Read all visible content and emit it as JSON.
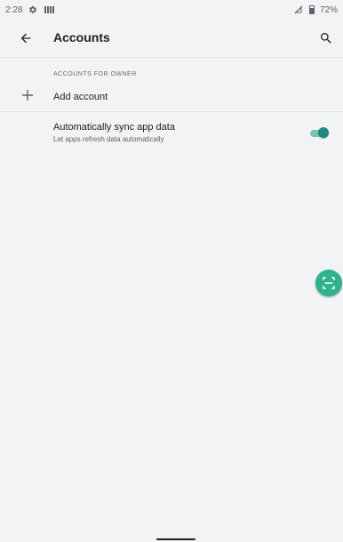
{
  "status": {
    "time": "2:28",
    "battery_percent": "72%",
    "icons": [
      "settings-icon",
      "sim-card-icon",
      "no-signal-icon",
      "battery-icon"
    ]
  },
  "appbar": {
    "title": "Accounts",
    "back_icon": "arrow-left-icon",
    "search_icon": "search-icon"
  },
  "accounts": {
    "section_header": "ACCOUNTS FOR OWNER",
    "add_label": "Add account",
    "add_icon": "plus-icon"
  },
  "sync": {
    "title": "Automatically sync app data",
    "subtitle": "Let apps refresh data automatically",
    "enabled": true
  },
  "colors": {
    "background": "#f1f3f4",
    "accent": "#1a8b7d",
    "fab": "#2fb38f"
  }
}
